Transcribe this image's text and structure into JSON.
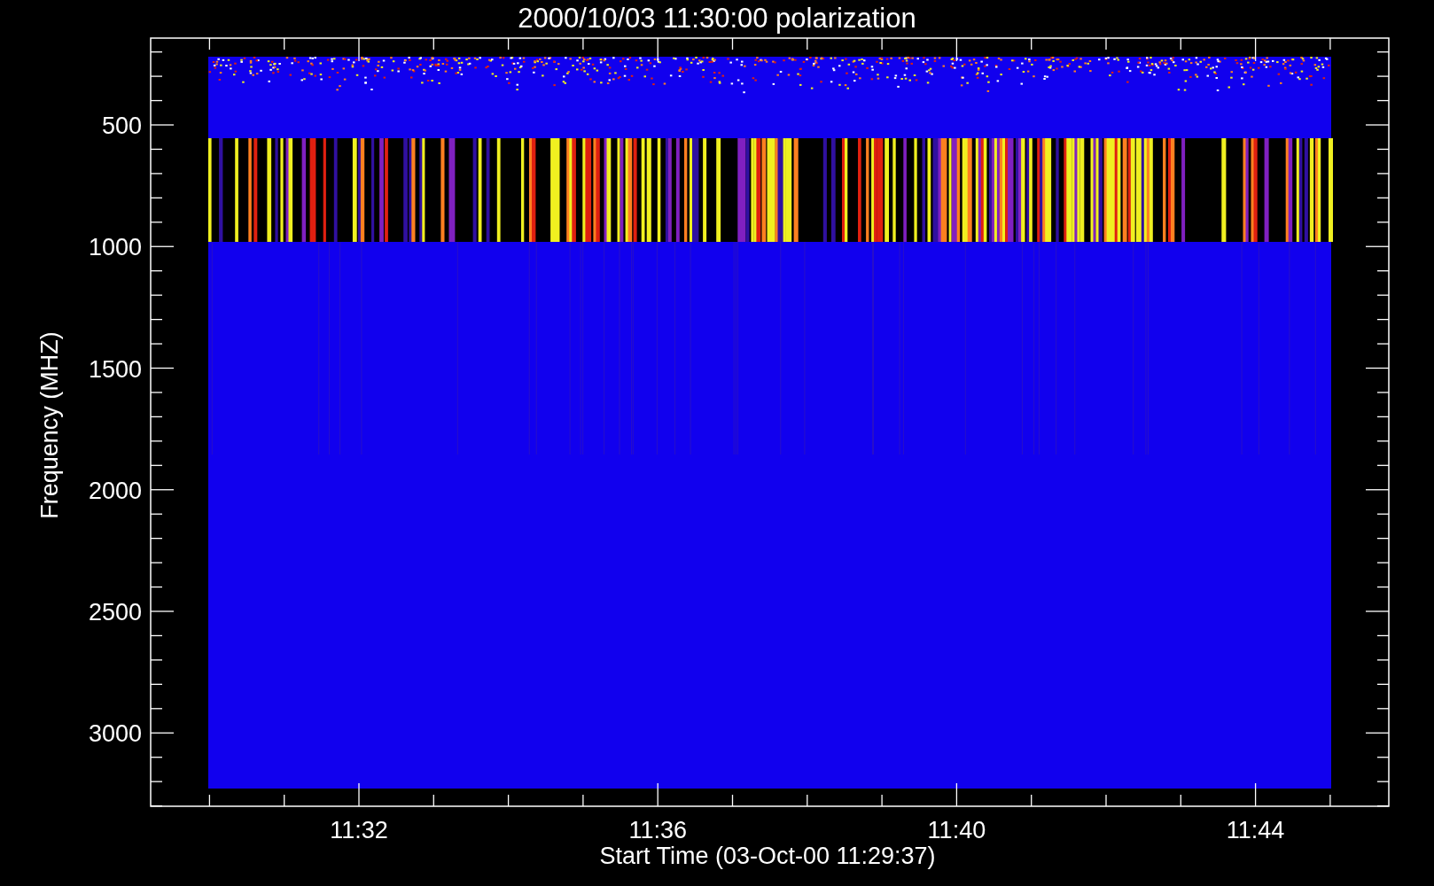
{
  "plot": {
    "title": "2000/10/03 11:30:00 polarization",
    "x_axis": {
      "label": "Start Time (03-Oct-00 11:29:37)",
      "ticks": [
        "11:32",
        "11:36",
        "11:40",
        "11:44"
      ]
    },
    "y_axis": {
      "label": "Frequency (MHZ)",
      "ticks": [
        "500",
        "1000",
        "1500",
        "2000",
        "2500",
        "3000"
      ]
    }
  }
}
